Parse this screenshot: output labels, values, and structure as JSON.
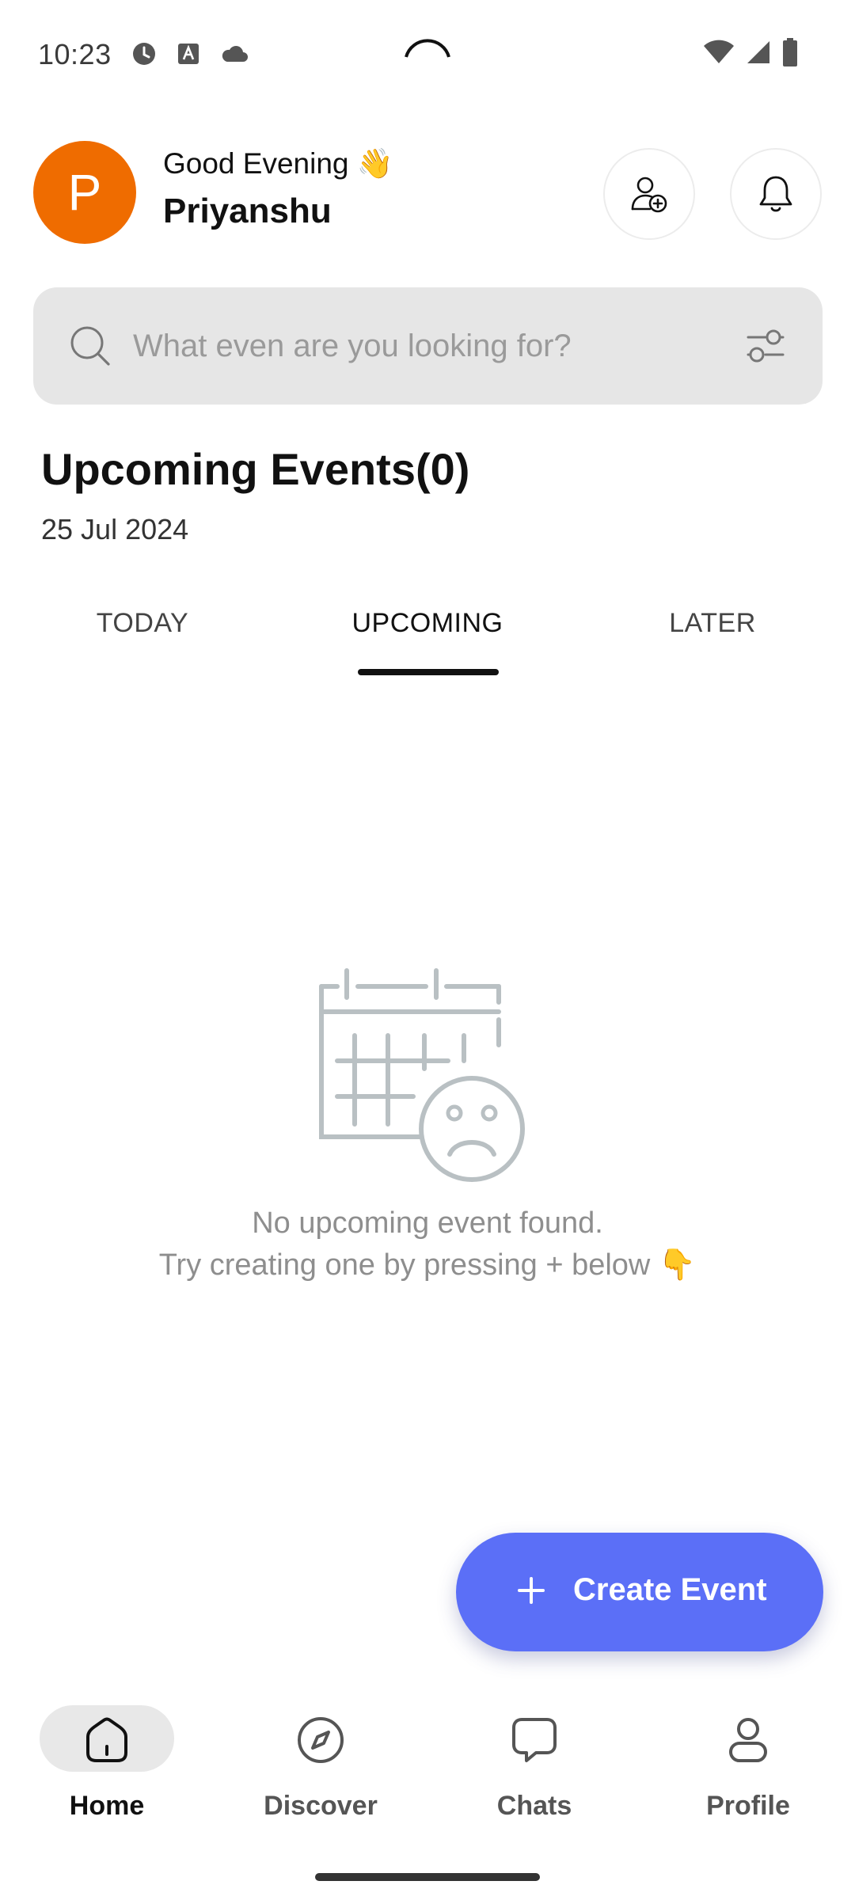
{
  "status_bar": {
    "time": "10:23"
  },
  "header": {
    "avatar_initial": "P",
    "greeting": "Good Evening 👋",
    "user_name": "Priyanshu"
  },
  "search": {
    "placeholder": "What even are you looking for?"
  },
  "events": {
    "title": "Upcoming Events(0)",
    "date": "25 Jul 2024",
    "tabs": [
      {
        "label": "TODAY",
        "active": false
      },
      {
        "label": "UPCOMING",
        "active": true
      },
      {
        "label": "LATER",
        "active": false
      }
    ],
    "empty_message_line1": "No upcoming event found.",
    "empty_message_line2": "Try creating one by pressing + below 👇"
  },
  "fab": {
    "label": "Create Event",
    "color": "#5b6ff7"
  },
  "bottom_nav": {
    "items": [
      {
        "label": "Home",
        "icon": "home-icon",
        "active": true
      },
      {
        "label": "Discover",
        "icon": "compass-icon",
        "active": false
      },
      {
        "label": "Chats",
        "icon": "chat-bubble-icon",
        "active": false
      },
      {
        "label": "Profile",
        "icon": "person-icon",
        "active": false
      }
    ]
  },
  "colors": {
    "avatar": "#ef6c00",
    "accent": "#5b6ff7",
    "search_bg": "#e6e6e6"
  }
}
